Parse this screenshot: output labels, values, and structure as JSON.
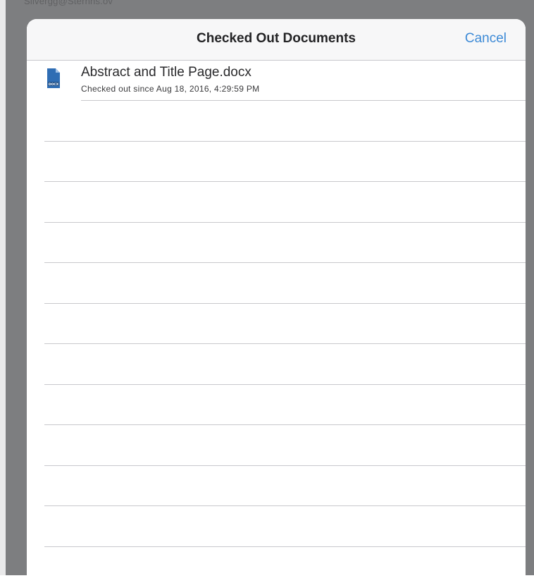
{
  "background": {
    "dim_color": "#7d7e80",
    "partial_text": "Silvergg@Sternhs.ov"
  },
  "sheet": {
    "title": "Checked Out Documents",
    "cancel_label": "Cancel",
    "accent_color": "#3d8ad6"
  },
  "documents": [
    {
      "name": "Abstract and Title Page.docx",
      "status": "Checked out since Aug 18, 2016, 4:29:59 PM",
      "icon": "word-document-icon",
      "icon_badge": "DOCX"
    }
  ],
  "empty_rows": 11
}
